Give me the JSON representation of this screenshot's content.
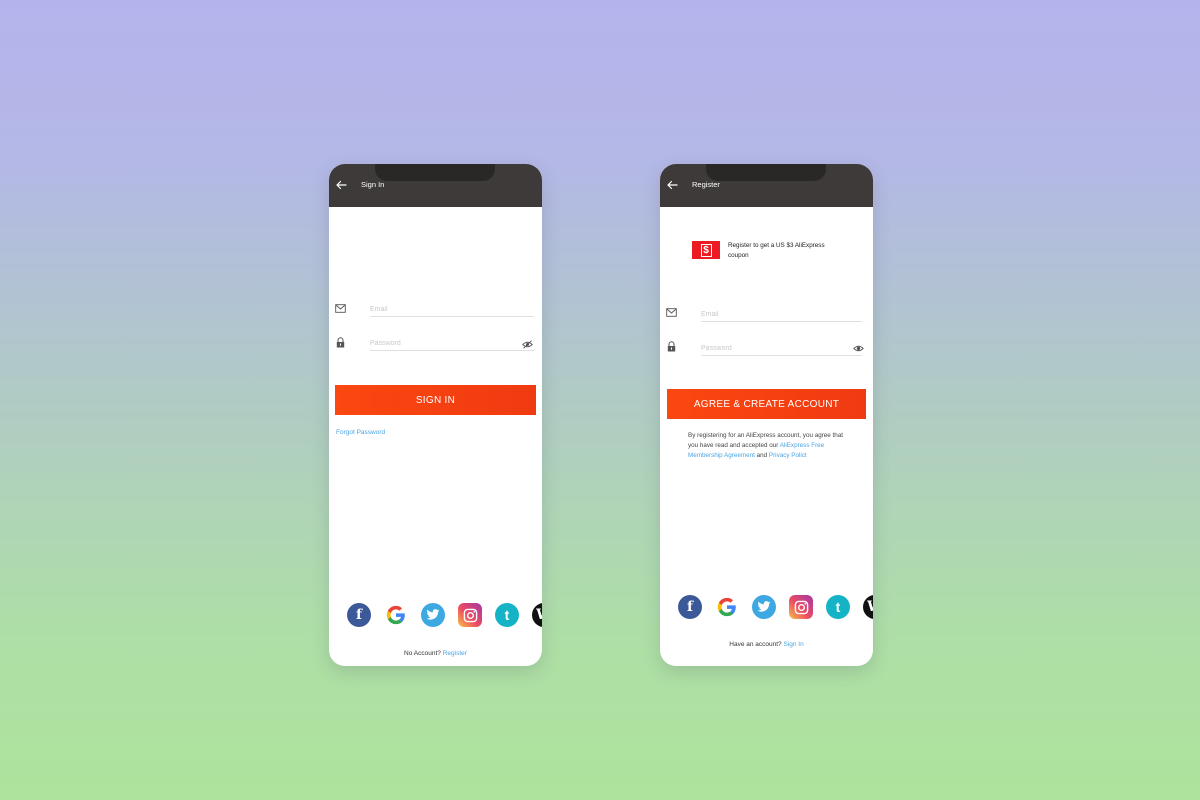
{
  "signin": {
    "title": "Sign In",
    "email_placeholder": "Email",
    "password_placeholder": "Password",
    "button": "SIGN IN",
    "forgot": "Forgot Password",
    "footer_text": "No Account?",
    "footer_link": "Register"
  },
  "register": {
    "title": "Register",
    "coupon_symbol": "$",
    "coupon_text": "Register to get a US $3 AliExpress coupon",
    "email_placeholder": "Email",
    "password_placeholder": "Password",
    "button": "AGREE & CREATE ACCOUNT",
    "terms_text": "By registering for an AliExpress account, you agree that you have read and accepted our",
    "terms_link1": "AliExpress Free Membership Agreement",
    "terms_and": "and",
    "terms_link2": "Privacy Polict",
    "footer_text": "Have an account?",
    "footer_link": "Sign In"
  },
  "social": {
    "icons": [
      "facebook-icon",
      "google-icon",
      "twitter-icon",
      "instagram-icon",
      "tumblr-icon",
      "wordpress-icon"
    ],
    "facebook_glyph": "f",
    "twitter_glyph": "",
    "tumblr_glyph": "t",
    "wordpress_glyph": "W"
  },
  "colors": {
    "accent": "#f6401a",
    "link": "#4ba3e3",
    "header": "#3e3a3a",
    "background_top": "#b5b3ec",
    "background_bottom": "#ade39c"
  }
}
